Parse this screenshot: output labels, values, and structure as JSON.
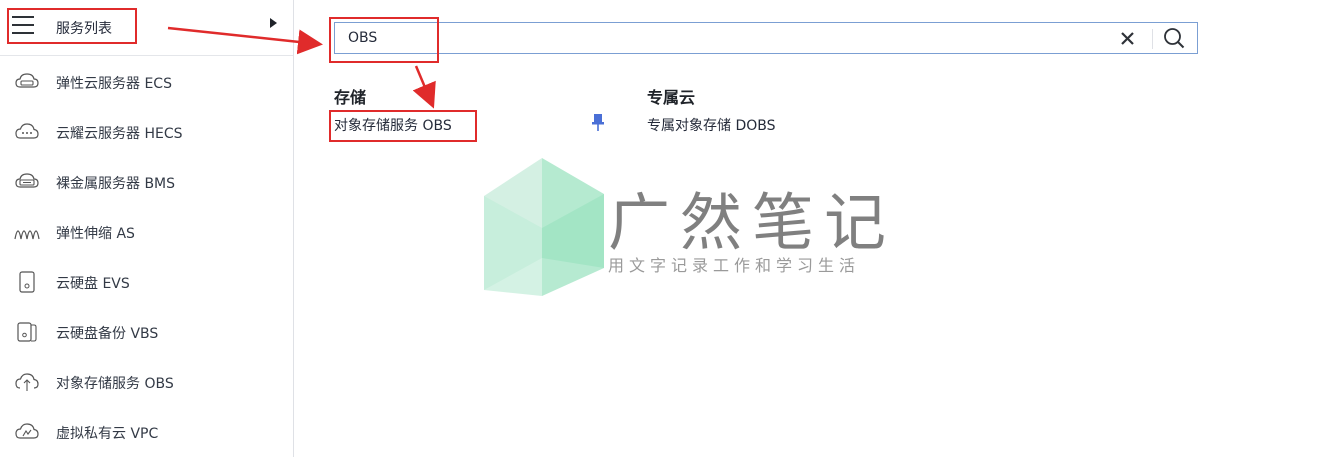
{
  "sidebar": {
    "title": "服务列表",
    "items": [
      {
        "label": "弹性云服务器 ECS",
        "icon": "cloud-server-icon"
      },
      {
        "label": "云耀云服务器 HECS",
        "icon": "cloud-dots-icon"
      },
      {
        "label": "裸金属服务器 BMS",
        "icon": "bare-metal-icon"
      },
      {
        "label": "弹性伸缩 AS",
        "icon": "auto-scaling-icon"
      },
      {
        "label": "云硬盘 EVS",
        "icon": "disk-icon"
      },
      {
        "label": "云硬盘备份 VBS",
        "icon": "disk-backup-icon"
      },
      {
        "label": "对象存储服务 OBS",
        "icon": "cloud-upload-icon"
      },
      {
        "label": "虚拟私有云 VPC",
        "icon": "vpc-cloud-icon"
      }
    ]
  },
  "search": {
    "value": "OBS"
  },
  "results": {
    "groups": [
      {
        "title": "存储",
        "items": [
          "对象存储服务 OBS"
        ]
      },
      {
        "title": "专属云",
        "items": [
          "专属对象存储 DOBS"
        ]
      }
    ]
  },
  "watermark": {
    "title": "广然笔记",
    "subtitle": "用文字记录工作和学习生活"
  },
  "colors": {
    "accent_border": "#7b9fd3",
    "annotation_red": "#e02b2b",
    "pin_blue": "#4a6fd6",
    "watermark_green": "#b8ecd2"
  }
}
